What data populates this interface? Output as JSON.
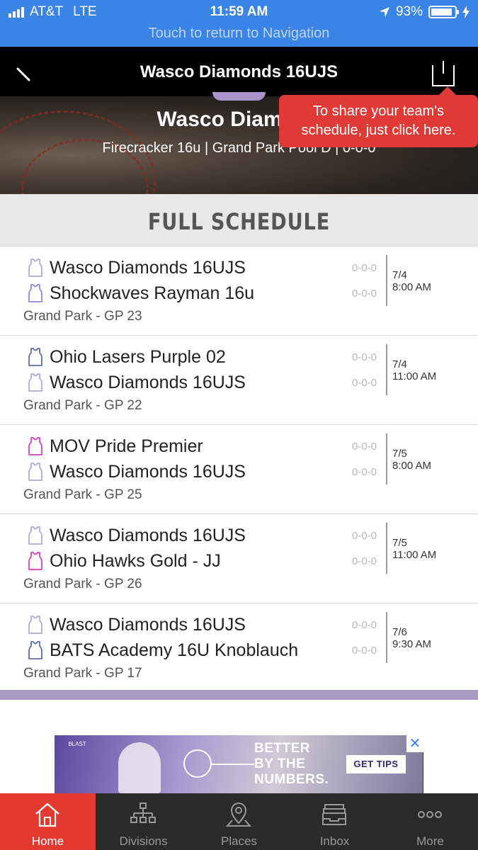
{
  "status_bar": {
    "carrier": "AT&T",
    "network": "LTE",
    "time": "11:59 AM",
    "battery": "93%",
    "battery_level": 0.93,
    "return_banner": "Touch to return to Navigation",
    "color": "#3a84e6"
  },
  "nav": {
    "title": "Wasco Diamonds 16UJS"
  },
  "team": {
    "name": "Wasco Diamond",
    "subtitle": "Firecracker 16u | Grand Park Pool D | 0-0-0"
  },
  "tooltip": {
    "line1": "To share your team's",
    "line2": "schedule, just click here.",
    "color": "#e03a37"
  },
  "section": {
    "title": "FULL SCHEDULE"
  },
  "games": [
    {
      "team1": "Wasco Diamonds 16UJS",
      "team1_jersey": "#b3a6e0",
      "score1": "0-0-0",
      "team2": "Shockwaves Rayman 16u",
      "team2_jersey": "#8f86e8",
      "score2": "0-0-0",
      "date": "7/4",
      "time": "8:00 AM",
      "venue": "Grand Park - GP 23"
    },
    {
      "team1": "Ohio Lasers Purple 02",
      "team1_jersey": "#5b6fb0",
      "score1": "0-0-0",
      "team2": "Wasco Diamonds 16UJS",
      "team2_jersey": "#b3a6e0",
      "score2": "0-0-0",
      "date": "7/4",
      "time": "11:00 AM",
      "venue": "Grand Park - GP 22"
    },
    {
      "team1": "MOV Pride Premier",
      "team1_jersey": "#d63fc6",
      "score1": "0-0-0",
      "team2": "Wasco Diamonds 16UJS",
      "team2_jersey": "#b3a6e0",
      "score2": "0-0-0",
      "date": "7/5",
      "time": "8:00 AM",
      "venue": "Grand Park - GP 25"
    },
    {
      "team1": "Wasco Diamonds 16UJS",
      "team1_jersey": "#b3a6e0",
      "score1": "0-0-0",
      "team2": "Ohio Hawks Gold - JJ",
      "team2_jersey": "#d63fc6",
      "score2": "0-0-0",
      "date": "7/5",
      "time": "11:00 AM",
      "venue": "Grand Park - GP 26"
    },
    {
      "team1": "Wasco Diamonds 16UJS",
      "team1_jersey": "#b3a6e0",
      "score1": "0-0-0",
      "team2": "BATS Academy 16U Knoblauch",
      "team2_jersey": "#5b6fb0",
      "score2": "0-0-0",
      "date": "7/6",
      "time": "9:30 AM",
      "venue": "Grand Park - GP 17"
    }
  ],
  "ad": {
    "logo": "BLAST",
    "headline1": "BETTER",
    "headline2": "BY THE",
    "headline3": "NUMBERS.",
    "cta": "GET TIPS",
    "close": "✕"
  },
  "tabs": [
    {
      "label": "Home",
      "icon": "home-icon",
      "active": true
    },
    {
      "label": "Divisions",
      "icon": "divisions-icon",
      "active": false
    },
    {
      "label": "Places",
      "icon": "places-icon",
      "active": false
    },
    {
      "label": "Inbox",
      "icon": "inbox-icon",
      "active": false
    },
    {
      "label": "More",
      "icon": "more-icon",
      "active": false
    }
  ]
}
